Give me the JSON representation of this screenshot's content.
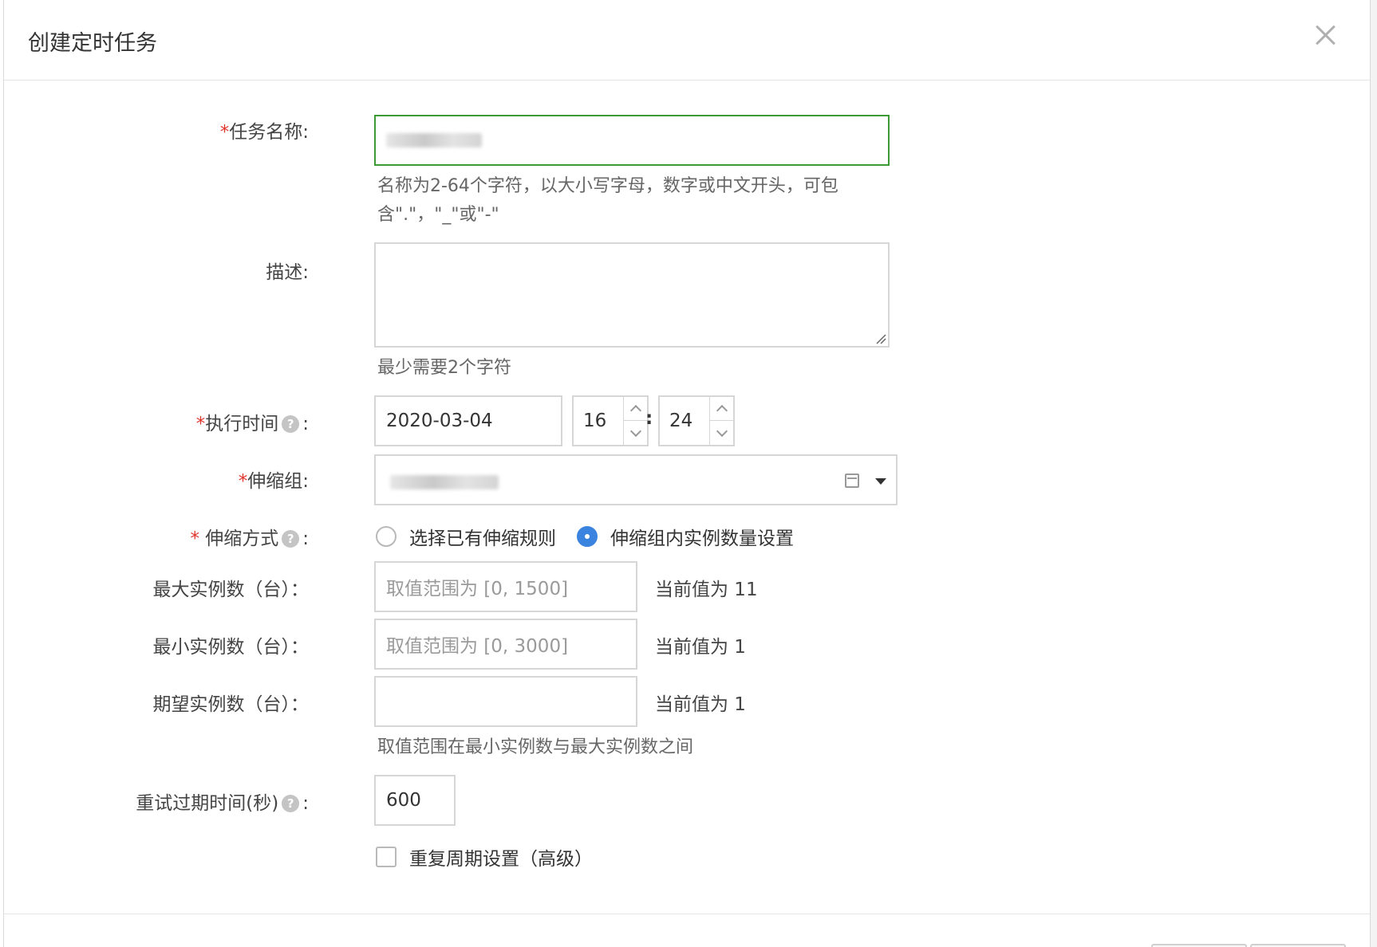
{
  "dialog": {
    "title": "创建定时任务"
  },
  "form": {
    "task_name": {
      "label": "任务名称:",
      "hint": "名称为2-64个字符，以大小写字母，数字或中文开头，可包含\".\"，\"_\"或\"-\""
    },
    "description": {
      "label": "描述:",
      "value": "",
      "hint": "最少需要2个字符"
    },
    "exec_time": {
      "label": "执行时间",
      "colon": ":",
      "date": "2020-03-04",
      "hour": "16",
      "separator": ":",
      "minute": "24"
    },
    "scaling_group": {
      "label": "伸缩组:"
    },
    "scaling_mode": {
      "label": " 伸缩方式",
      "colon": ":",
      "options": [
        {
          "label": "选择已有伸缩规则",
          "selected": false
        },
        {
          "label": "伸缩组内实例数量设置",
          "selected": true
        }
      ]
    },
    "max_instances": {
      "label": "最大实例数（台）：",
      "placeholder": "取值范围为 [0, 1500]",
      "current": "当前值为 11"
    },
    "min_instances": {
      "label": "最小实例数（台）：",
      "placeholder": "取值范围为 [0, 3000]",
      "current": "当前值为 1"
    },
    "desired_instances": {
      "label": "期望实例数（台）：",
      "value": "",
      "current": "当前值为 1",
      "hint": "取值范围在最小实例数与最大实例数之间"
    },
    "retry_expire": {
      "label": "重试过期时间(秒)",
      "colon": ":",
      "value": "600"
    },
    "repeat": {
      "label": "重复周期设置（高级）",
      "checked": false
    }
  },
  "icons": {
    "help": "?"
  },
  "colors": {
    "required": "#e0352b",
    "focus_border": "#3c9a36",
    "radio_selected": "#3a84e0"
  }
}
